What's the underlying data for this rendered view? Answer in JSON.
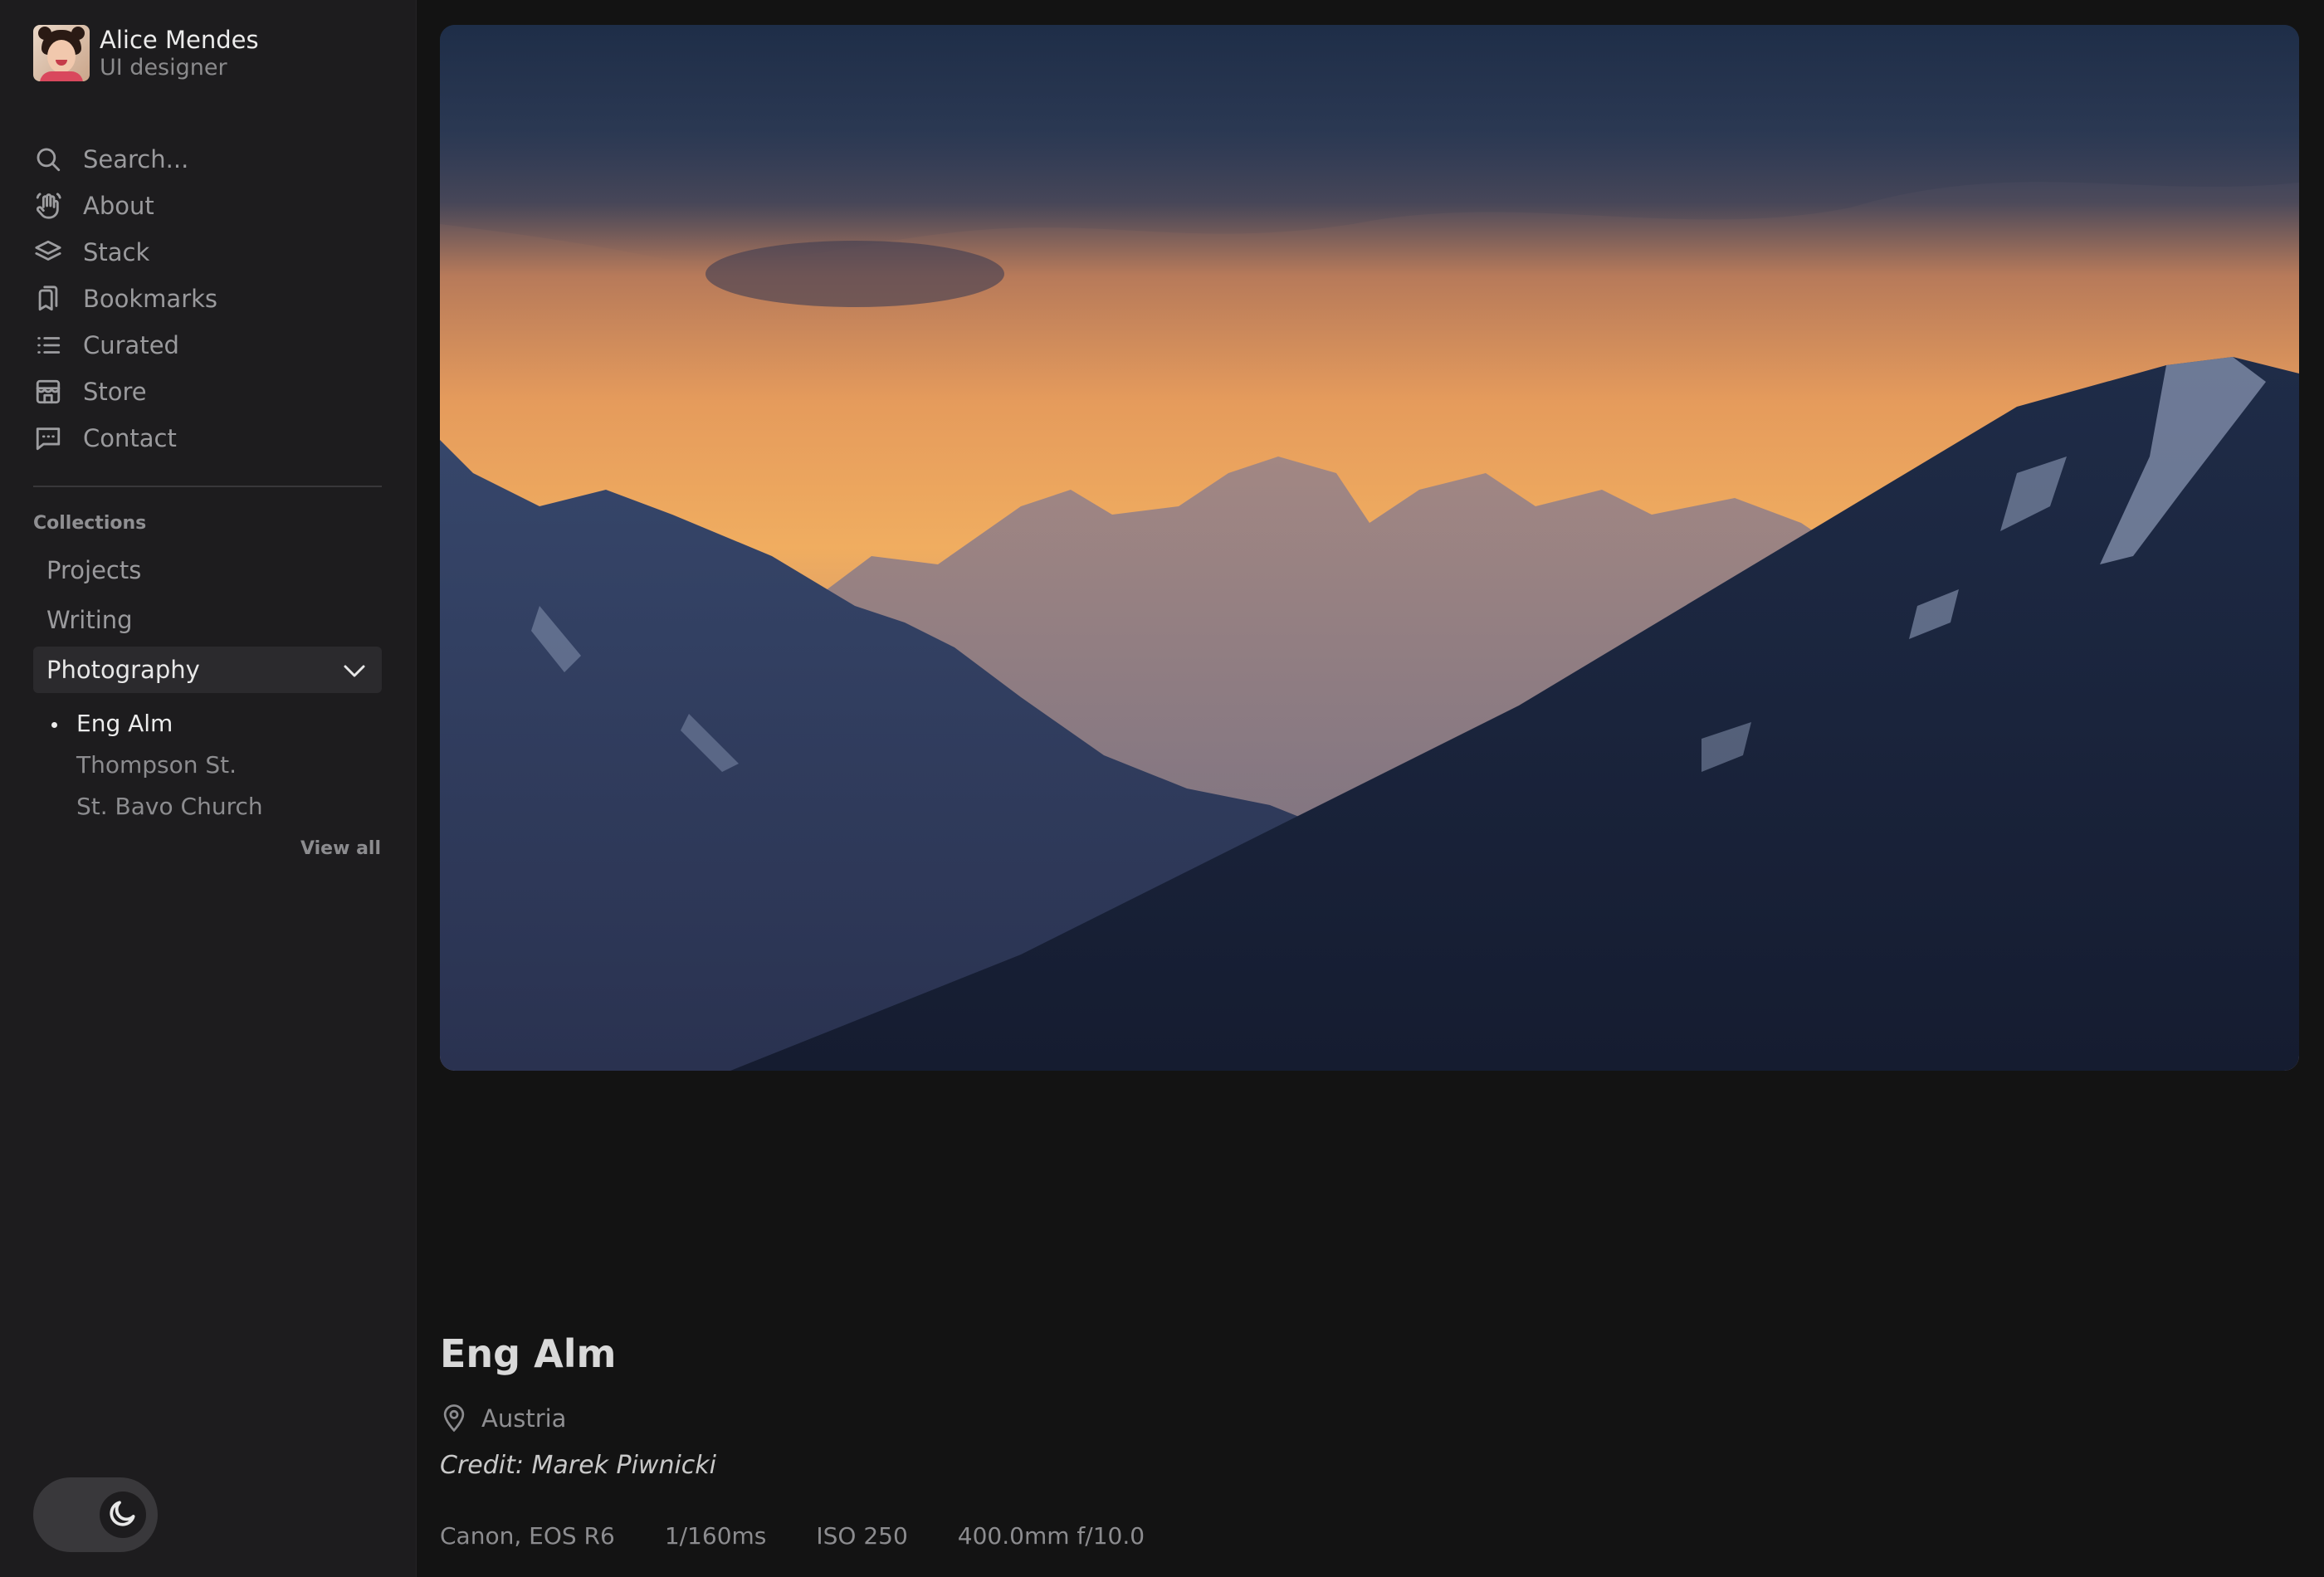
{
  "profile": {
    "name": "Alice Mendes",
    "role": "UI designer"
  },
  "search": {
    "placeholder": "Search..."
  },
  "nav": [
    {
      "label": "About",
      "icon": "hand-wave-icon"
    },
    {
      "label": "Stack",
      "icon": "layers-icon"
    },
    {
      "label": "Bookmarks",
      "icon": "bookmarks-icon"
    },
    {
      "label": "Curated",
      "icon": "list-icon"
    },
    {
      "label": "Store",
      "icon": "store-icon"
    },
    {
      "label": "Contact",
      "icon": "message-icon"
    }
  ],
  "collections": {
    "title": "Collections",
    "items": [
      "Projects",
      "Writing",
      "Photography"
    ],
    "active": "Photography",
    "photography_items": [
      "Eng Alm",
      "Thompson St.",
      "St. Bavo Church"
    ],
    "view_all": "View all"
  },
  "theme_toggle": {
    "mode": "dark",
    "icon": "moon-icon"
  },
  "photo": {
    "title": "Eng Alm",
    "location": "Austria",
    "credit": "Credit: Marek Piwnicki",
    "exif": [
      "Canon, EOS R6",
      "1/160ms",
      "ISO 250",
      "400.0mm f/10.0"
    ]
  }
}
